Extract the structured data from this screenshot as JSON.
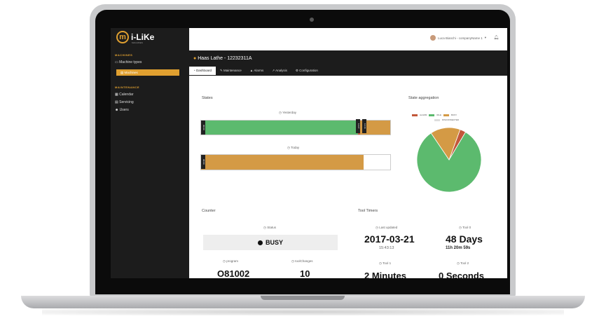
{
  "sidebar": {
    "logo_text": "i-LiKe",
    "logo_mark": "m",
    "logo_sub": "MACHINES",
    "sections": [
      {
        "heading": "MACHINES",
        "items": [
          "Machine types",
          "Machines"
        ]
      },
      {
        "heading": "MAINTENANCE",
        "items": [
          "Calendar",
          "Servicing",
          "Users"
        ]
      }
    ]
  },
  "topbar": {
    "user": "Luca Bianchi - companyName 1"
  },
  "machine": {
    "title": "Haas Lathe - 12232311A"
  },
  "tabs": [
    "Dashboard",
    "Maintenance",
    "Alarms",
    "Analysis",
    "Configuration"
  ],
  "states": {
    "title": "States",
    "yesterday_label": "Yesterday",
    "today_label": "Today",
    "yesterday_start": "00:00",
    "yesterday_m1": "13:27",
    "yesterday_m2": "13:36",
    "today_start": "00:00",
    "colors": {
      "idle": "#5cba6e",
      "busy": "#d49a45",
      "alarm": "#c2573a"
    }
  },
  "aggregation": {
    "title": "State aggregation",
    "legend": [
      "ALARM",
      "IDLE",
      "BUSY"
    ],
    "sublegend": "DISCONNECTED",
    "chart_data": {
      "type": "pie",
      "labels": [
        "ALARM",
        "IDLE",
        "BUSY"
      ],
      "values": [
        3,
        82,
        15
      ]
    }
  },
  "counter": {
    "title": "Counter",
    "status_label": "Status",
    "status_value": "BUSY",
    "program_label": "program",
    "program_value": "O81002",
    "toolchanges_label": "toolChanges",
    "toolchanges_value": "10"
  },
  "tool_timers": {
    "title": "Tool Timers",
    "last_updated_label": "Last updated",
    "last_updated_date": "2017-03-21",
    "last_updated_time": "15:43:13",
    "tool0_label": "Tool 0",
    "tool0_value": "48 Days",
    "tool0_sub": "11h 20m 59s",
    "tool1_label": "Tool 1",
    "tool1_value": "2 Minutes",
    "tool2_label": "Tool 2",
    "tool2_value": "0 Seconds"
  }
}
